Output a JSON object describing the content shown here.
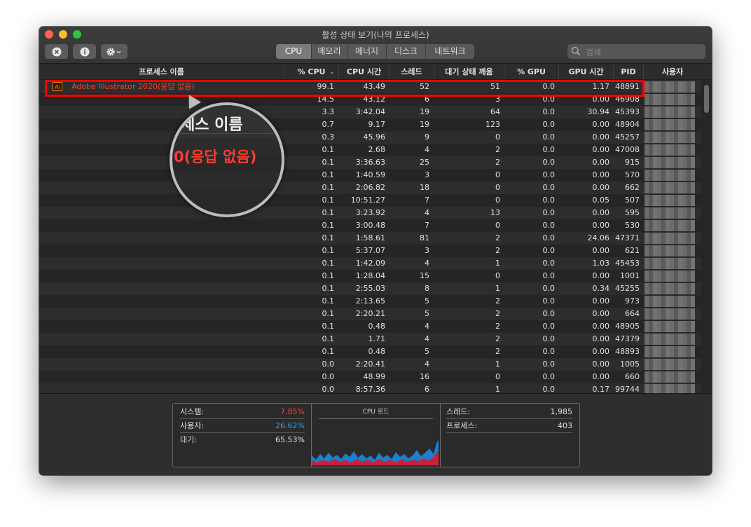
{
  "window": {
    "title": "활성 상태 보기(나의 프로세스)"
  },
  "toolbar": {
    "tabs": [
      {
        "label": "CPU",
        "active": true
      },
      {
        "label": "메모리",
        "active": false
      },
      {
        "label": "에너지",
        "active": false
      },
      {
        "label": "디스크",
        "active": false
      },
      {
        "label": "네트워크",
        "active": false
      }
    ],
    "search_placeholder": "검색"
  },
  "columns": [
    "프로세스 이름",
    "% CPU",
    "CPU 시간",
    "스레드",
    "대기 상태 깨움",
    "% GPU",
    "GPU 시간",
    "PID",
    "사용자"
  ],
  "highlighted_process": {
    "name": "Adobe Illustrator 2020(응답 없음)",
    "icon": "Ai"
  },
  "rows": [
    {
      "cpu": "99.1",
      "time": "43.49",
      "threads": "52",
      "wakeups": "51",
      "gpu": "0.0",
      "gputime": "1.17",
      "pid": "48891"
    },
    {
      "cpu": "14.5",
      "time": "43.12",
      "threads": "6",
      "wakeups": "3",
      "gpu": "0.0",
      "gputime": "0.00",
      "pid": "46908"
    },
    {
      "cpu": "3.3",
      "time": "3:42.04",
      "threads": "19",
      "wakeups": "64",
      "gpu": "0.0",
      "gputime": "30.94",
      "pid": "45393"
    },
    {
      "cpu": "0.7",
      "time": "9.17",
      "threads": "19",
      "wakeups": "123",
      "gpu": "0.0",
      "gputime": "0.00",
      "pid": "48904"
    },
    {
      "cpu": "0.3",
      "time": "45.96",
      "threads": "9",
      "wakeups": "0",
      "gpu": "0.0",
      "gputime": "0.00",
      "pid": "45257"
    },
    {
      "cpu": "0.1",
      "time": "2.68",
      "threads": "4",
      "wakeups": "2",
      "gpu": "0.0",
      "gputime": "0.00",
      "pid": "47008"
    },
    {
      "cpu": "0.1",
      "time": "3:36.63",
      "threads": "25",
      "wakeups": "2",
      "gpu": "0.0",
      "gputime": "0.00",
      "pid": "915"
    },
    {
      "cpu": "0.1",
      "time": "1:40.59",
      "threads": "3",
      "wakeups": "0",
      "gpu": "0.0",
      "gputime": "0.00",
      "pid": "570"
    },
    {
      "cpu": "0.1",
      "time": "2:06.82",
      "threads": "18",
      "wakeups": "0",
      "gpu": "0.0",
      "gputime": "0.00",
      "pid": "662"
    },
    {
      "cpu": "0.1",
      "time": "10:51.27",
      "threads": "7",
      "wakeups": "0",
      "gpu": "0.0",
      "gputime": "0.05",
      "pid": "507"
    },
    {
      "cpu": "0.1",
      "time": "3:23.92",
      "threads": "4",
      "wakeups": "13",
      "gpu": "0.0",
      "gputime": "0.00",
      "pid": "595"
    },
    {
      "cpu": "0.1",
      "time": "3:00.48",
      "threads": "7",
      "wakeups": "0",
      "gpu": "0.0",
      "gputime": "0.00",
      "pid": "530"
    },
    {
      "cpu": "0.1",
      "time": "1:58.61",
      "threads": "81",
      "wakeups": "2",
      "gpu": "0.0",
      "gputime": "24.06",
      "pid": "47371"
    },
    {
      "cpu": "0.1",
      "time": "5:37.07",
      "threads": "3",
      "wakeups": "2",
      "gpu": "0.0",
      "gputime": "0.00",
      "pid": "621"
    },
    {
      "cpu": "0.1",
      "time": "1:42.09",
      "threads": "4",
      "wakeups": "1",
      "gpu": "0.0",
      "gputime": "1.03",
      "pid": "45453"
    },
    {
      "cpu": "0.1",
      "time": "1:28.04",
      "threads": "15",
      "wakeups": "0",
      "gpu": "0.0",
      "gputime": "0.00",
      "pid": "1001"
    },
    {
      "cpu": "0.1",
      "time": "2:55.03",
      "threads": "8",
      "wakeups": "1",
      "gpu": "0.0",
      "gputime": "0.34",
      "pid": "45255"
    },
    {
      "cpu": "0.1",
      "time": "2:13.65",
      "threads": "5",
      "wakeups": "2",
      "gpu": "0.0",
      "gputime": "0.00",
      "pid": "973"
    },
    {
      "cpu": "0.1",
      "time": "2:20.21",
      "threads": "5",
      "wakeups": "2",
      "gpu": "0.0",
      "gputime": "0.00",
      "pid": "664"
    },
    {
      "cpu": "0.1",
      "time": "0.48",
      "threads": "4",
      "wakeups": "2",
      "gpu": "0.0",
      "gputime": "0.00",
      "pid": "48905"
    },
    {
      "cpu": "0.1",
      "time": "1.71",
      "threads": "4",
      "wakeups": "2",
      "gpu": "0.0",
      "gputime": "0.00",
      "pid": "47379"
    },
    {
      "cpu": "0.1",
      "time": "0.48",
      "threads": "5",
      "wakeups": "2",
      "gpu": "0.0",
      "gputime": "0.00",
      "pid": "48893"
    },
    {
      "cpu": "0.0",
      "time": "2:20.41",
      "threads": "4",
      "wakeups": "1",
      "gpu": "0.0",
      "gputime": "0.00",
      "pid": "1005"
    },
    {
      "cpu": "0.0",
      "time": "48.99",
      "threads": "16",
      "wakeups": "0",
      "gpu": "0.0",
      "gputime": "0.00",
      "pid": "660"
    },
    {
      "cpu": "0.0",
      "time": "8:57.36",
      "threads": "6",
      "wakeups": "1",
      "gpu": "0.0",
      "gputime": "0.17",
      "pid": "99744"
    }
  ],
  "magnifier": {
    "header_text": "세스 이름",
    "row_text": "0(응답 없음)"
  },
  "footer": {
    "system_label": "시스템:",
    "system_value": "7.85%",
    "system_color": "#ff3b30",
    "user_label": "사용자:",
    "user_value": "26.62%",
    "user_color": "#2aa0e8",
    "idle_label": "대기:",
    "idle_value": "65.53%",
    "graph_title": "CPU 로드",
    "threads_label": "스레드:",
    "threads_value": "1,985",
    "processes_label": "프로세스:",
    "processes_value": "403"
  }
}
